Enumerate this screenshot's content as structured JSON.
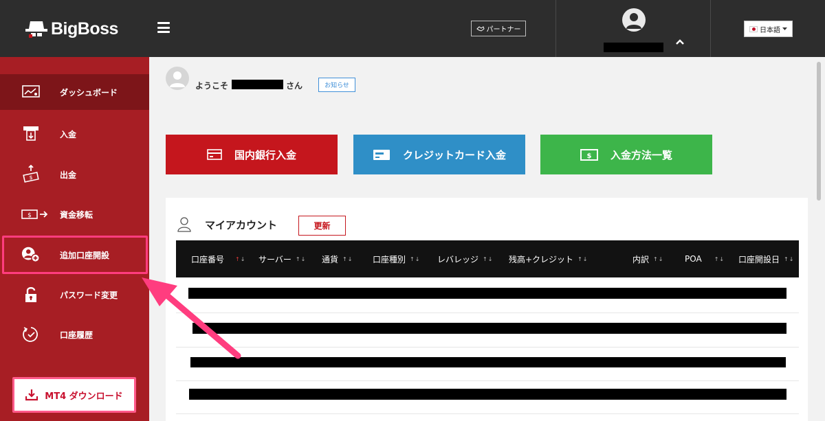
{
  "header": {
    "logo_text": "BigBoss",
    "partner_label": "パートナー",
    "language_label": "日本語"
  },
  "sidebar": {
    "items": [
      {
        "label": "ダッシュボード",
        "icon": "dashboard-chart-icon"
      },
      {
        "label": "入金",
        "icon": "deposit-icon"
      },
      {
        "label": "出金",
        "icon": "withdraw-icon"
      },
      {
        "label": "資金移転",
        "icon": "transfer-icon"
      },
      {
        "label": "追加口座開設",
        "icon": "add-account-icon"
      },
      {
        "label": "パスワード変更",
        "icon": "lock-icon"
      },
      {
        "label": "口座履歴",
        "icon": "history-clock-icon"
      }
    ],
    "download_label": "MT4 ダウンロード"
  },
  "welcome": {
    "prefix": "ようこそ",
    "suffix": "さん",
    "notice_label": "お知らせ"
  },
  "actions": {
    "bank_label": "国内銀行入金",
    "card_label": "クレジットカード入金",
    "list_label": "入金方法一覧"
  },
  "account": {
    "title": "マイアカウント",
    "refresh_label": "更新",
    "columns": [
      "口座番号",
      "サーバー",
      "通貨",
      "口座種別",
      "レバレッジ",
      "残高+クレジット",
      "内訳",
      "POA",
      "口座開設日"
    ]
  },
  "colors": {
    "sidebar": "#a71e24",
    "sidebar_active": "#7d1519",
    "topbar": "#2d2d2d",
    "bank": "#c5161d",
    "card": "#2f8fc7",
    "list": "#3db54a",
    "annotation": "#ff3d7f"
  }
}
